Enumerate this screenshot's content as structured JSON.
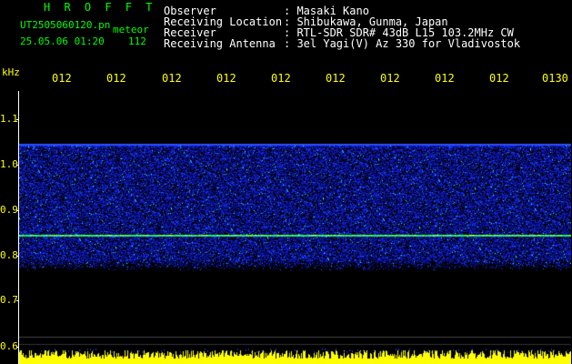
{
  "header": {
    "brand": "H R O F F T",
    "filename": "UT2505060120.pn",
    "type": "meteor",
    "datetime": "25.05.06 01:20",
    "count": "112"
  },
  "meta": [
    {
      "label": "Observer",
      "value": ": Masaki Kano"
    },
    {
      "label": "Receiving Location",
      "value": ": Shibukawa, Gunma, Japan"
    },
    {
      "label": "Receiver",
      "value": ": RTL-SDR SDR# 43dB L15 103.2MHz CW"
    },
    {
      "label": "Receiving Antenna",
      "value": ": 3el Yagi(V) Az 330 for Vladivostok"
    }
  ],
  "axis": {
    "unit": "kHz",
    "time_labels": [
      "012",
      "012",
      "012",
      "012",
      "012",
      "012",
      "012",
      "012",
      "012",
      "0130"
    ],
    "freq_labels": [
      "1.1",
      "1.0",
      "0.9",
      "0.8",
      "0.7",
      "0.6"
    ]
  },
  "colors": {
    "text_header": "#00ff00",
    "text_meta": "#ffffff",
    "text_axis": "#ffff00",
    "noise": "#0a1aff",
    "line": "#00ff66",
    "bottom_bars": "#ffff00"
  }
}
